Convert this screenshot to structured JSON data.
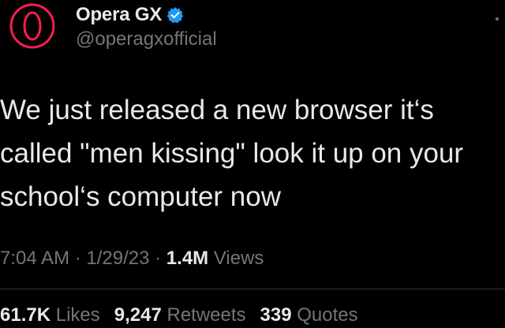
{
  "author": {
    "display_name": "Opera GX",
    "handle": "@operagxofficial",
    "verified": true,
    "avatar_icon": "opera-gx-logo-icon",
    "verified_icon": "verified-badge-icon"
  },
  "tweet": {
    "lines": [
      "We just released a new browser it‘s",
      "called \"men kissing\" look it up on your",
      "school‘s computer now"
    ]
  },
  "meta": {
    "time": "7:04 AM",
    "sep1": " · ",
    "date": "1/29/23",
    "sep2": " · ",
    "views_count": "1.4M",
    "views_label": " Views"
  },
  "stats": {
    "likes_count": "61.7K",
    "likes_label": " Likes",
    "retweets_count": "9,247",
    "retweets_label": " Retweets",
    "quotes_count": "339",
    "quotes_label": " Quotes"
  },
  "colors": {
    "background": "#000000",
    "text_primary": "#e7e9ea",
    "text_secondary": "#71767b",
    "brand_red": "#fa1e4e",
    "verified_blue": "#1d9bf0",
    "divider": "#2f3336"
  }
}
